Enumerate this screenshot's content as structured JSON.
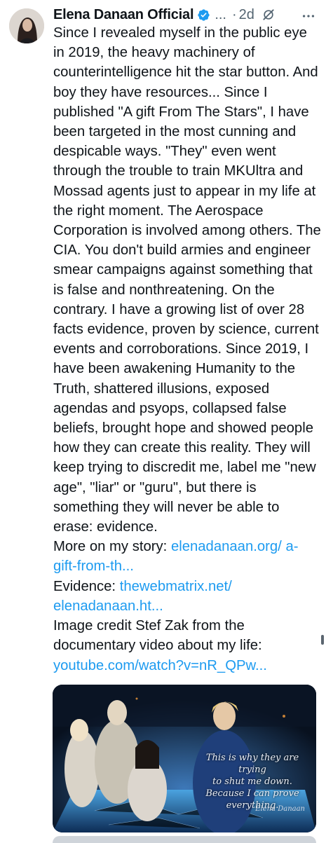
{
  "tweet": {
    "author_name": "Elena Danaan Official",
    "handle": "...",
    "separator": "·",
    "time": "2d",
    "paragraphs": [
      "Since I revealed myself in the public eye in 2019, the heavy machinery of counterintelligence hit the star button. And boy they have resources... Since I published \"A gift From The Stars\", I have been targeted in the most cunning and despicable ways. \"They\" even went through the trouble to train MKUltra and Mossad agents just to appear in my life at the right moment. The Aerospace Corporation is involved among others. The CIA. You don't build armies and engineer smear campaigns against something that is false and nonthreatening. On the contrary. I have a growing list of over 28 facts evidence, proven by science, current events and corroborations. Since 2019, I have been awakening Humanity to the Truth, shattered illusions, exposed agendas and psyops, collapsed false beliefs, brought hope and showed people how they can create this reality. They will keep trying to discredit me, label me \"new age\", \"liar\" or \"guru\", but there is something they will never be able to erase: evidence."
    ],
    "story_label": "More on my story: ",
    "story_link": "elenadanaan.org/ a-gift-from-th...",
    "evidence_label": "Evidence: ",
    "evidence_link": "thewebmatrix.net/ elenadanaan.ht...",
    "credit_text": "Image credit Stef Zak from the documentary video about my life: ",
    "video_link": "youtube.com/watch?v=nR_QPw...",
    "image": {
      "caption_line1": "This is why they are trying",
      "caption_line2": "to shut me down.",
      "caption_line3": "Because I can prove",
      "caption_line4": "everything.",
      "signature": "Elena Danaan"
    }
  },
  "icons": {
    "verified": "verified-badge-icon",
    "grok": "grok-icon",
    "more": "more-options-icon"
  },
  "colors": {
    "text": "#0f1419",
    "muted": "#536471",
    "link": "#1d9bf0",
    "verified": "#1d9bf0"
  }
}
